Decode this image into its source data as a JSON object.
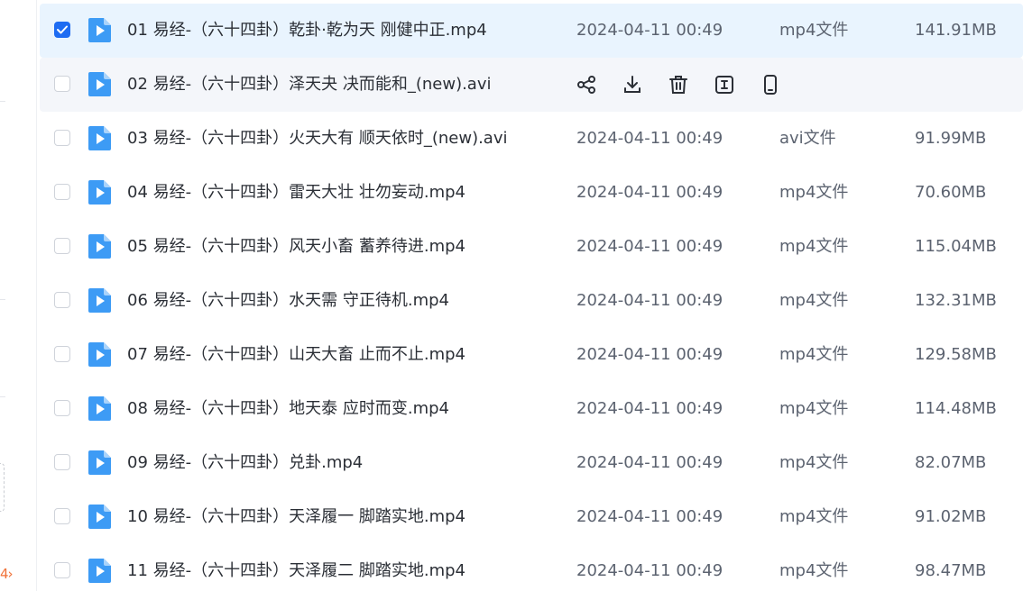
{
  "colors": {
    "selected_row_bg": "#e9f4fe",
    "hover_row_bg": "#f4f6fa",
    "checkbox_checked": "#1e6cf2",
    "file_icon": "#3d9bf5",
    "text_primary": "#2b2f36",
    "text_secondary": "#5c6370",
    "accent_orange": "#f0733a"
  },
  "left_strip": {
    "partial_text": "4›"
  },
  "hover_actions": [
    {
      "name": "share-icon",
      "label": "分享"
    },
    {
      "name": "download-icon",
      "label": "下载"
    },
    {
      "name": "trash-icon",
      "label": "删除"
    },
    {
      "name": "rename-icon",
      "label": "重命名"
    },
    {
      "name": "phone-icon",
      "label": "手机查看"
    }
  ],
  "files": [
    {
      "name": "01 易经-（六十四卦）乾卦·乾为天 刚健中正.mp4",
      "date": "2024-04-11 00:49",
      "type": "mp4文件",
      "size": "141.91MB",
      "checked": true,
      "state": "selected"
    },
    {
      "name": "02 易经-（六十四卦）泽天夬 决而能和_(new).avi",
      "date": "",
      "type": "",
      "size": "",
      "checked": false,
      "state": "hover"
    },
    {
      "name": "03 易经-（六十四卦）火天大有 顺天依时_(new).avi",
      "date": "2024-04-11 00:49",
      "type": "avi文件",
      "size": "91.99MB",
      "checked": false,
      "state": "normal"
    },
    {
      "name": "04 易经-（六十四卦）雷天大壮 壮勿妄动.mp4",
      "date": "2024-04-11 00:49",
      "type": "mp4文件",
      "size": "70.60MB",
      "checked": false,
      "state": "normal"
    },
    {
      "name": "05 易经-（六十四卦）风天小畜 蓄养待进.mp4",
      "date": "2024-04-11 00:49",
      "type": "mp4文件",
      "size": "115.04MB",
      "checked": false,
      "state": "normal"
    },
    {
      "name": "06 易经-（六十四卦）水天需 守正待机.mp4",
      "date": "2024-04-11 00:49",
      "type": "mp4文件",
      "size": "132.31MB",
      "checked": false,
      "state": "normal"
    },
    {
      "name": "07 易经-（六十四卦）山天大畜 止而不止.mp4",
      "date": "2024-04-11 00:49",
      "type": "mp4文件",
      "size": "129.58MB",
      "checked": false,
      "state": "normal"
    },
    {
      "name": "08 易经-（六十四卦）地天泰 应时而变.mp4",
      "date": "2024-04-11 00:49",
      "type": "mp4文件",
      "size": "114.48MB",
      "checked": false,
      "state": "normal"
    },
    {
      "name": "09 易经-（六十四卦）兑卦.mp4",
      "date": "2024-04-11 00:49",
      "type": "mp4文件",
      "size": "82.07MB",
      "checked": false,
      "state": "normal"
    },
    {
      "name": "10 易经-（六十四卦）天泽履一 脚踏实地.mp4",
      "date": "2024-04-11 00:49",
      "type": "mp4文件",
      "size": "91.02MB",
      "checked": false,
      "state": "normal"
    },
    {
      "name": "11 易经-（六十四卦）天泽履二 脚踏实地.mp4",
      "date": "2024-04-11 00:49",
      "type": "mp4文件",
      "size": "98.47MB",
      "checked": false,
      "state": "normal"
    }
  ]
}
